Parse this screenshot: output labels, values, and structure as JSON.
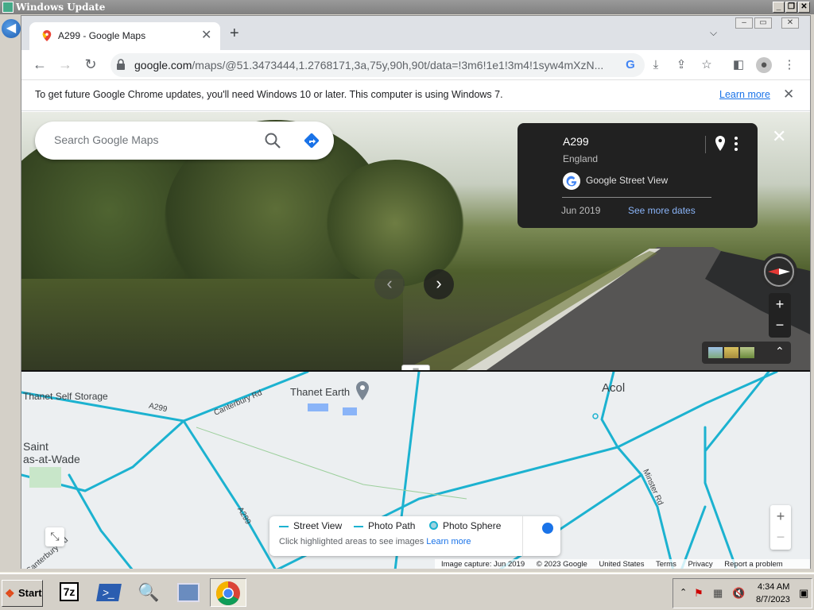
{
  "background_window": {
    "title": "Windows Update"
  },
  "browser": {
    "tab": {
      "title": "A299 - Google Maps",
      "close": "✕"
    },
    "new_tab": "+",
    "url": {
      "host": "google.com",
      "rest": "/maps/@51.3473444,1.2768171,3a,75y,90h,90t/data=!3m6!1e1!3m4!1syw4mXzN..."
    },
    "infobar": {
      "message": "To get future Google Chrome updates, you'll need Windows 10 or later. This computer is using Windows 7.",
      "learn_more": "Learn more"
    }
  },
  "maps": {
    "search": {
      "placeholder": "Search Google Maps"
    },
    "street_view_card": {
      "road": "A299",
      "region": "England",
      "source": "Google Street View",
      "date": "Jun 2019",
      "more_dates": "See more dates"
    },
    "map_labels": {
      "storage": "Thanet Self Storage",
      "place_earth": "Thanet Earth",
      "village_acol": "Acol",
      "saint_line1": "Saint",
      "saint_line2": "as-at-Wade",
      "road_a299_a": "A299",
      "road_a299_b": "A299",
      "road_canterbury": "Canterbury Rd",
      "road_canterbury_b": "Canterbury Rd",
      "road_minster": "Minster Rd"
    },
    "legend": {
      "street_view": "Street View",
      "photo_path": "Photo Path",
      "photo_sphere": "Photo Sphere",
      "hint": "Click highlighted areas to see images",
      "learn_more": "Learn more"
    },
    "footer": {
      "capture": "Image capture: Jun 2019",
      "copyright": "© 2023 Google",
      "country": "United States",
      "terms": "Terms",
      "privacy": "Privacy",
      "report": "Report a problem"
    },
    "colors": {
      "coverage": "#1cb2d0",
      "card_bg": "#212121",
      "link": "#8ab4f8"
    }
  },
  "taskbar": {
    "start": "Start",
    "apps": [
      "7z",
      "powershell-icon",
      "search-tool-icon",
      "network-tool-icon",
      "chrome-icon"
    ],
    "clock": {
      "time": "4:34 AM",
      "date": "8/7/2023"
    }
  }
}
